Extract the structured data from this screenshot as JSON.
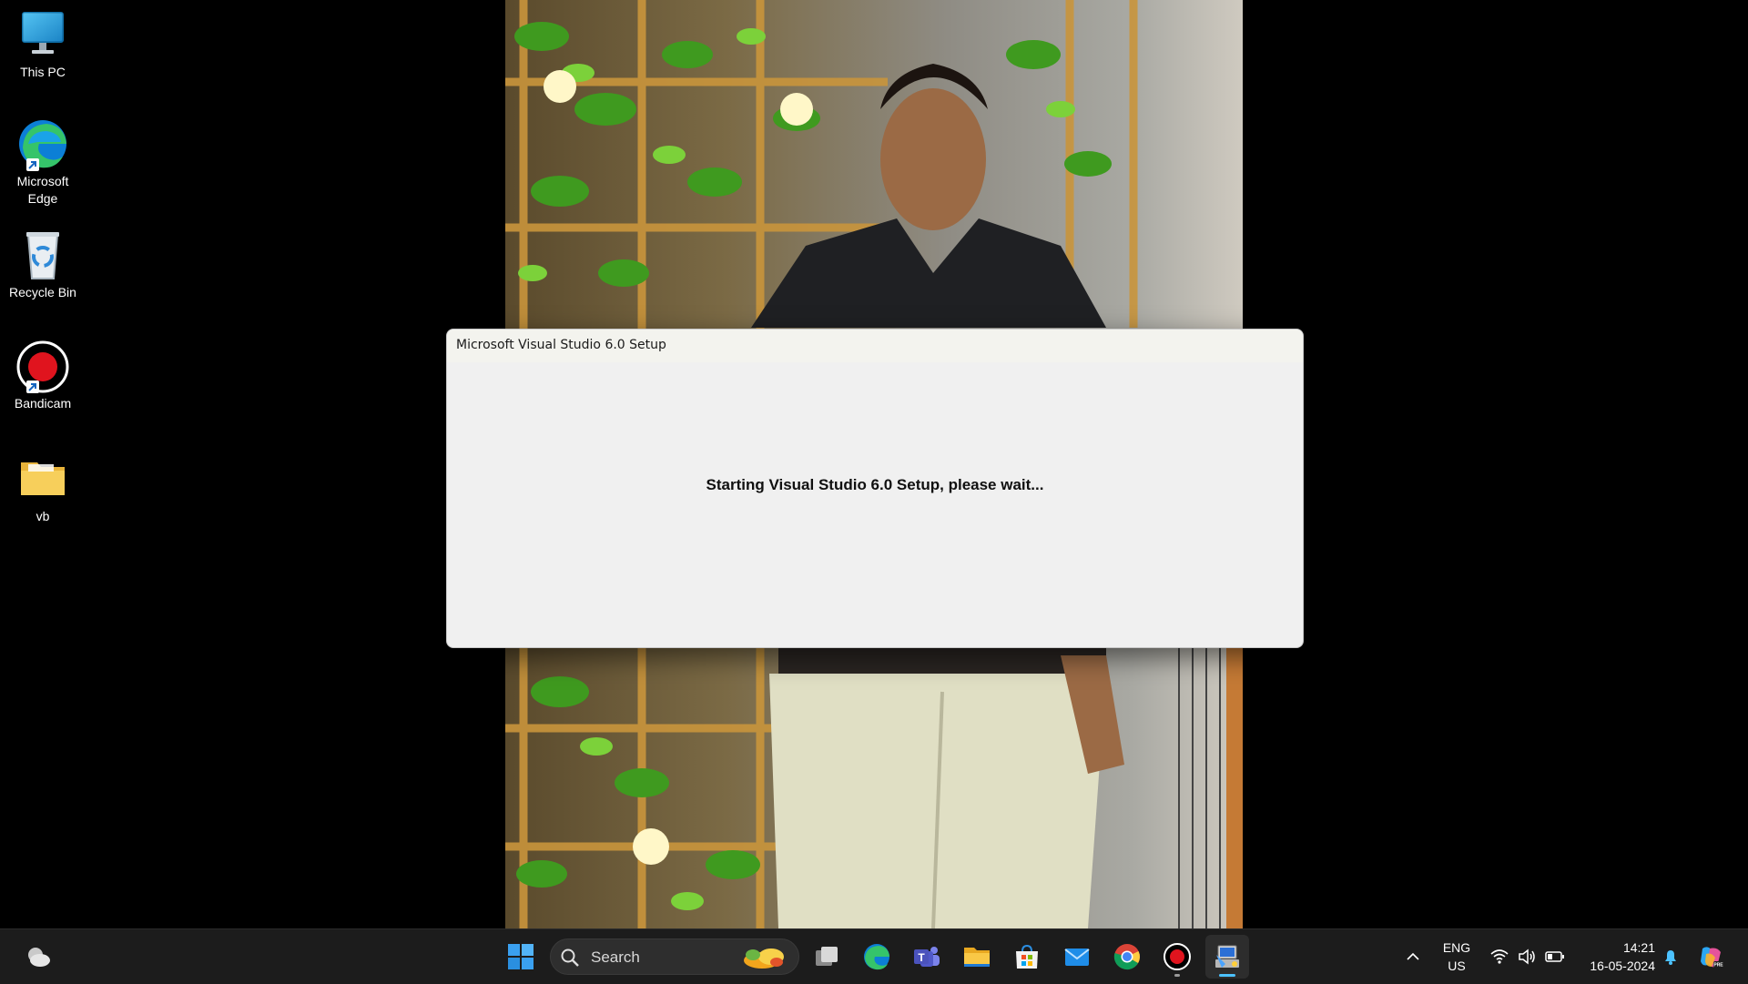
{
  "desktop": {
    "icons": [
      {
        "label": "This PC"
      },
      {
        "label": "Microsoft Edge"
      },
      {
        "label": "Recycle Bin"
      },
      {
        "label": "Bandicam"
      },
      {
        "label": "vb"
      }
    ]
  },
  "dialog": {
    "title": "Microsoft Visual Studio 6.0 Setup",
    "message": "Starting Visual Studio 6.0 Setup, please wait..."
  },
  "taskbar": {
    "search_label": "Search",
    "apps": [
      {
        "icon": "windows-start-icon"
      },
      {
        "icon": "task-view-icon"
      },
      {
        "icon": "edge-icon"
      },
      {
        "icon": "teams-icon"
      },
      {
        "icon": "file-explorer-icon"
      },
      {
        "icon": "microsoft-store-icon"
      },
      {
        "icon": "mail-icon"
      },
      {
        "icon": "chrome-icon"
      },
      {
        "icon": "bandicam-icon",
        "running": true
      },
      {
        "icon": "visual-studio-setup-icon",
        "active": true
      }
    ],
    "tray": {
      "language_line1": "ENG",
      "language_line2": "US",
      "time": "14:21",
      "date": "16-05-2024"
    }
  },
  "colors": {
    "accent": "#4cc2ff",
    "taskbar": "#1c1c1c",
    "dialog_bg": "#f0f0f0",
    "bandicam_red": "#e0141e"
  }
}
